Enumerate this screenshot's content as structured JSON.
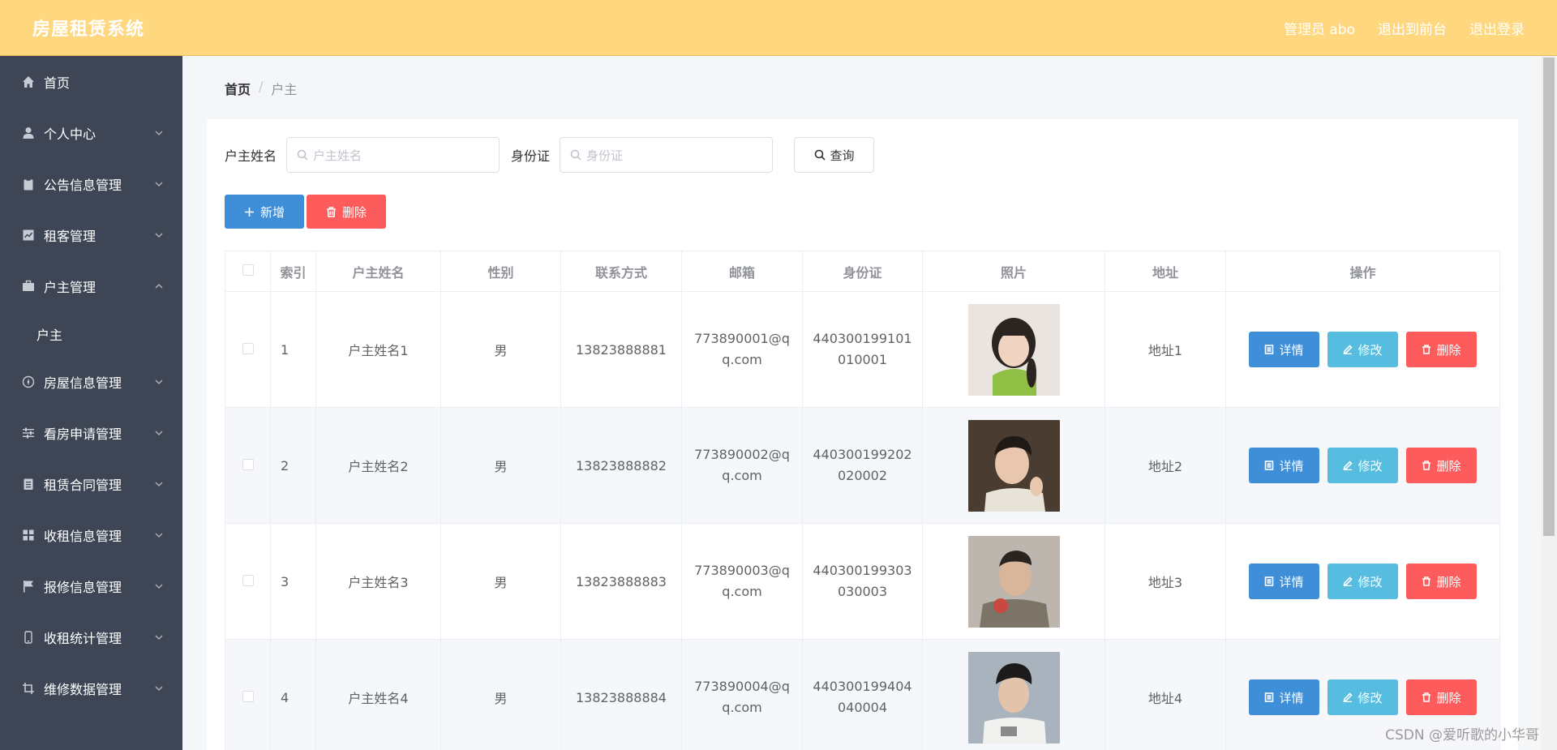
{
  "header": {
    "brand": "房屋租赁系统",
    "nav": [
      "管理员 abo",
      "退出到前台",
      "退出登录"
    ]
  },
  "sidebar": {
    "items": [
      {
        "label": "首页",
        "icon": "home-icon",
        "chevron": ""
      },
      {
        "label": "个人中心",
        "icon": "user-icon",
        "chevron": "down"
      },
      {
        "label": "公告信息管理",
        "icon": "clipboard-icon",
        "chevron": "down"
      },
      {
        "label": "租客管理",
        "icon": "chart-icon",
        "chevron": "down"
      },
      {
        "label": "户主管理",
        "icon": "briefcase-icon",
        "chevron": "up"
      },
      {
        "label": "房屋信息管理",
        "icon": "compass-icon",
        "chevron": "down"
      },
      {
        "label": "看房申请管理",
        "icon": "sliders-icon",
        "chevron": "down"
      },
      {
        "label": "租赁合同管理",
        "icon": "document-icon",
        "chevron": "down"
      },
      {
        "label": "收租信息管理",
        "icon": "grid-icon",
        "chevron": "down"
      },
      {
        "label": "报修信息管理",
        "icon": "flag-icon",
        "chevron": "down"
      },
      {
        "label": "收租统计管理",
        "icon": "phone-icon",
        "chevron": "down"
      },
      {
        "label": "维修数据管理",
        "icon": "crop-icon",
        "chevron": "down"
      }
    ],
    "submenu_label": "户主"
  },
  "breadcrumb": {
    "home": "首页",
    "separator": "/",
    "current": "户主"
  },
  "search": {
    "name_label": "户主姓名",
    "name_placeholder": "户主姓名",
    "id_label": "身份证",
    "id_placeholder": "身份证",
    "query_label": "查询"
  },
  "actions": {
    "add_label": "新增",
    "delete_label": "删除"
  },
  "table": {
    "columns": [
      "索引",
      "户主姓名",
      "性别",
      "联系方式",
      "邮箱",
      "身份证",
      "照片",
      "地址",
      "操作"
    ],
    "op_labels": {
      "detail": "详情",
      "edit": "修改",
      "delete": "删除"
    },
    "rows": [
      {
        "index": "1",
        "name": "户主姓名1",
        "gender": "男",
        "phone": "13823888881",
        "email": "773890001@qq.com",
        "id_card": "440300199101010001",
        "address": "地址1"
      },
      {
        "index": "2",
        "name": "户主姓名2",
        "gender": "男",
        "phone": "13823888882",
        "email": "773890002@qq.com",
        "id_card": "440300199202020002",
        "address": "地址2"
      },
      {
        "index": "3",
        "name": "户主姓名3",
        "gender": "男",
        "phone": "13823888883",
        "email": "773890003@qq.com",
        "id_card": "440300199303030003",
        "address": "地址3"
      },
      {
        "index": "4",
        "name": "户主姓名4",
        "gender": "男",
        "phone": "13823888884",
        "email": "773890004@qq.com",
        "id_card": "440300199404040004",
        "address": "地址4"
      }
    ]
  },
  "watermark": "CSDN @爱听歌的小华哥",
  "colors": {
    "header": "#fed77f",
    "sidebar": "#3e4655",
    "primary": "#3f8fd8",
    "info": "#56bde0",
    "danger": "#fe5c5c"
  }
}
